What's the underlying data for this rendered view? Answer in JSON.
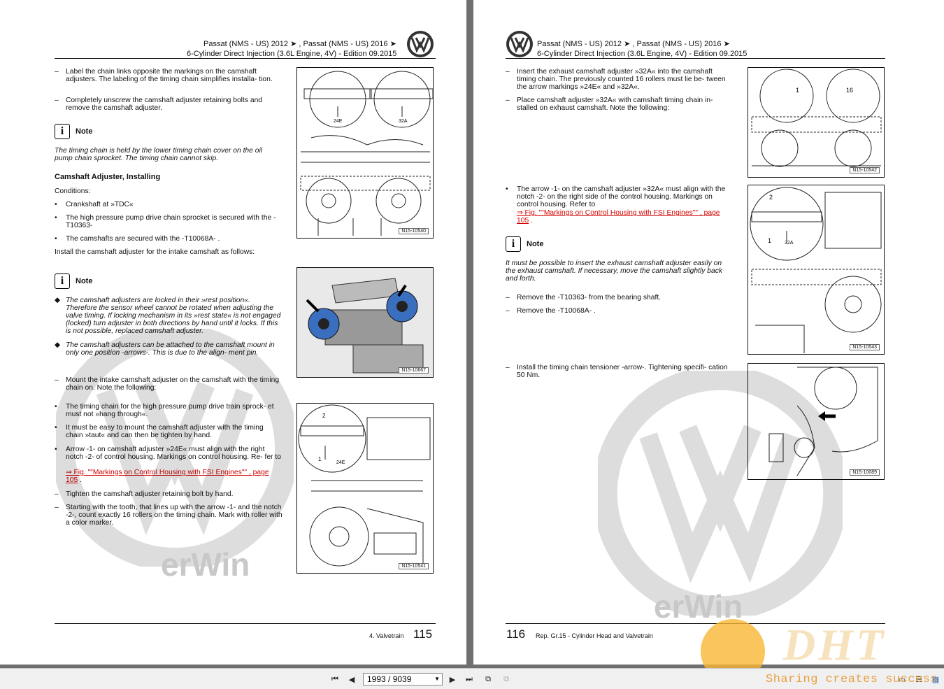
{
  "header": {
    "model_line": "Passat (NMS - US) 2012 ➤ , Passat (NMS - US) 2016 ➤",
    "engine_line": "6-Cylinder Direct Injection (3.6L Engine, 4V) - Edition 09.2015"
  },
  "left_page": {
    "step1": "Label the chain links opposite the markings on the camshaft adjusters. The labeling of the timing chain simplifies installa- tion.",
    "step2": "Completely unscrew the camshaft adjuster retaining bolts and remove the camshaft adjuster.",
    "note1_label": "Note",
    "note1_text": "The timing chain is held by the lower timing chain cover on the oil pump chain sprocket. The timing chain cannot skip.",
    "section_title": "Camshaft Adjuster, Installing",
    "conditions_label": "Conditions:",
    "cond1": "Crankshaft at »TDC«",
    "cond2": "The high pressure pump drive chain sprocket is secured with the -T10363-",
    "cond3": "The camshafts are secured with the -T10068A- .",
    "install_intro": "Install the camshaft adjuster for the intake camshaft as follows:",
    "note2_label": "Note",
    "note2_b1": "The camshaft adjusters are locked in their »rest position«. Therefore the sensor wheel cannot be rotated when adjusting the valve timing. If locking mechanism in its »rest state« is not engaged (locked) turn adjuster in both directions by hand until it locks. If this is not possible, replaced camshaft adjuster.",
    "note2_b2": "The camshaft adjusters can be attached to the camshaft mount in only one position -arrows-. This is due to the align- ment pin.",
    "step3": "Mount the intake camshaft adjuster on the camshaft with the timing chain on. Note the following:",
    "sub1": "The timing chain for the high pressure pump drive train sprock- et must not »hang through«.",
    "sub2": "It must be easy to mount the camshaft adjuster with the timing chain »taut« and can then be tighten by hand.",
    "sub3": "Arrow -1- on camshaft adjuster »24E« must align with the right notch -2- of control housing. Markings on control housing. Re- fer to",
    "sub3_link": "⇒ Fig. \"\"Markings on Control Housing with FSI Engines\"\" , page 105",
    "sub3_tail": ".",
    "step4": "Tighten the camshaft adjuster retaining bolt by hand.",
    "step5": "Starting with the tooth, that lines up with the arrow -1- and the notch -2-, count exactly 16 rollers on the timing chain. Mark with roller with a color marker.",
    "fig1_id": "N15-10540",
    "fig2_id": "N15-10667",
    "fig3_id": "N15-10541",
    "fig1_l1": "24E",
    "fig1_l2": "32A",
    "fig3_l1": "2",
    "fig3_l2": "1",
    "fig3_l3": "24E",
    "footer_section": "4. Valvetrain",
    "footer_page": "115"
  },
  "right_page": {
    "step1": "Insert the exhaust camshaft adjuster »32A« into the camshaft timing chain. The previously counted 16 rollers must lie be- tween the arrow markings »24E« and »32A«.",
    "step2": "Place camshaft adjuster »32A« with camshaft timing chain in- stalled on exhaust camshaft. Note the following:",
    "sub1": "The arrow -1- on the camshaft adjuster »32A« must align with the notch -2- on the right side of the control housing. Markings on control housing. Refer to",
    "sub1_link": "⇒ Fig. \"\"Markings on Control Housing with FSI Engines\"\" , page 105",
    "sub1_tail": ".",
    "note_label": "Note",
    "note_text": "It must be possible to insert the exhaust camshaft adjuster easily on the exhaust camshaft. If necessary, move the camshaft slightly back and forth.",
    "step3": "Remove the -T10363- from the bearing shaft.",
    "step4": "Remove the -T10068A- .",
    "step5": "Install the timing chain tensioner -arrow-. Tightening specifi- cation 50 Nm.",
    "fig1_id": "N15-10542",
    "fig2_id": "N15-10543",
    "fig3_id": "N15-10089",
    "fig1_l1": "1",
    "fig1_l2": "16",
    "fig2_l1": "2",
    "fig2_l2": "1",
    "fig2_l3": "32A",
    "footer_page": "116",
    "footer_section": "Rep. Gr.15 - Cylinder Head and Valvetrain"
  },
  "watermark": {
    "brand": "erWin",
    "site_tagline": "Sharing creates success",
    "site_logo": "DHT"
  },
  "toolbar": {
    "page_indicator": "1993 / 9039"
  },
  "colors": {
    "link_red": "#d40000",
    "viewer_bg": "#6f6f6f",
    "toolbar_bg": "#f0f0f0",
    "watermark_orange": "#f7b733"
  }
}
